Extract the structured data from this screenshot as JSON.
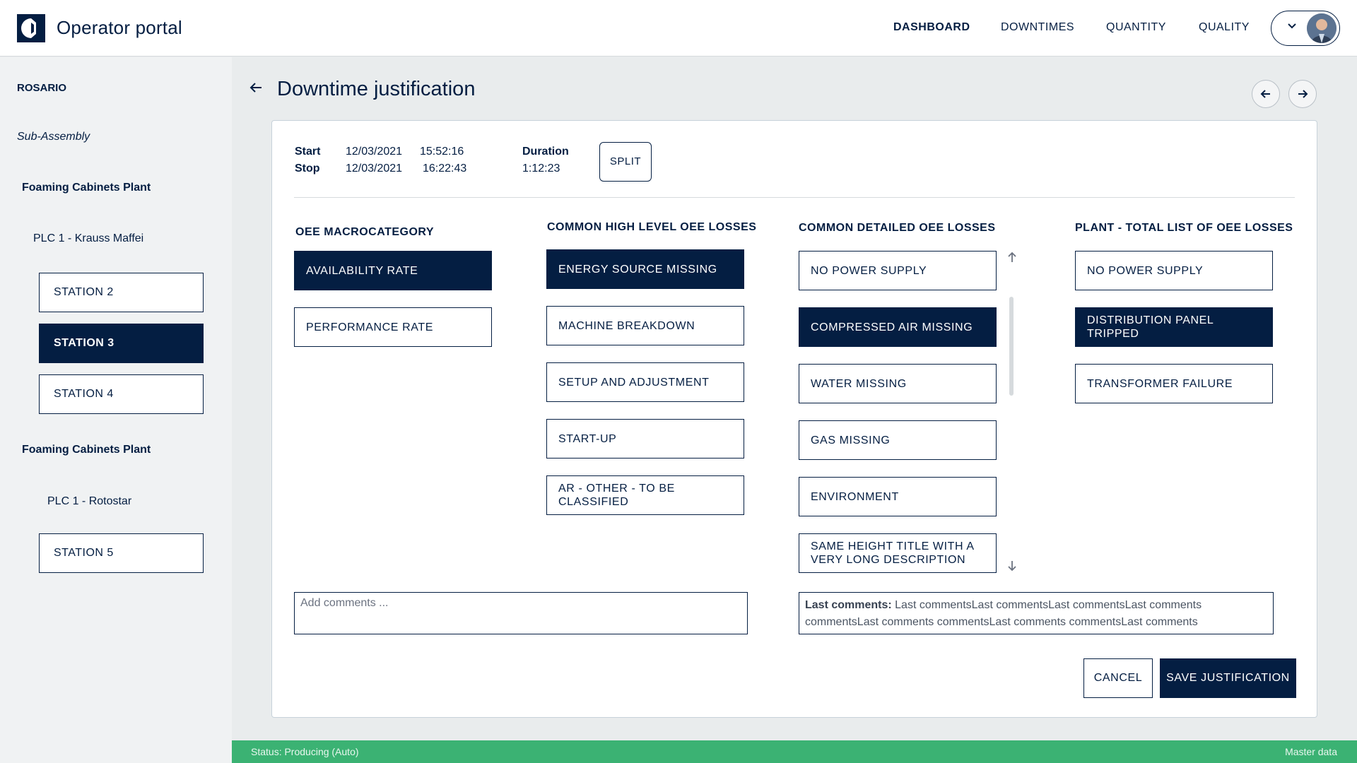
{
  "header": {
    "app_title": "Operator portal",
    "nav": [
      "DASHBOARD",
      "DOWNTIMES",
      "QUANTITY",
      "QUALITY"
    ],
    "active_nav": "DASHBOARD"
  },
  "sidebar": {
    "site": "ROSARIO",
    "area": "Sub-Assembly",
    "groups": [
      {
        "plant": "Foaming Cabinets Plant",
        "plc": "PLC 1 - Krauss Maffei",
        "stations": [
          "STATION 2",
          "STATION 3",
          "STATION 4"
        ]
      },
      {
        "plant": "Foaming Cabinets Plant",
        "plc": "PLC 1 - Rotostar",
        "stations": [
          "STATION 5"
        ]
      }
    ],
    "active_station": "STATION 3"
  },
  "page": {
    "title": "Downtime justification"
  },
  "downtime": {
    "start_label": "Start",
    "start_date": "12/03/2021",
    "start_time": "15:52:16",
    "stop_label": "Stop",
    "stop_date": "12/03/2021",
    "stop_time": "16:22:43",
    "duration_label": "Duration",
    "duration_value": "1:12:23",
    "split_label": "SPLIT"
  },
  "columns": [
    {
      "title": "OEE MACROCATEGORY",
      "items": [
        "AVAILABILITY RATE",
        "PERFORMANCE RATE"
      ],
      "selected": 0
    },
    {
      "title": "COMMON HIGH LEVEL OEE LOSSES",
      "items": [
        "ENERGY SOURCE MISSING",
        "MACHINE BREAKDOWN",
        "SETUP AND ADJUSTMENT",
        "START-UP",
        "AR - OTHER - TO BE CLASSIFIED"
      ],
      "selected": 0
    },
    {
      "title": "COMMON DETAILED OEE LOSSES",
      "items": [
        "NO POWER SUPPLY",
        "COMPRESSED AIR MISSING",
        "WATER MISSING",
        "GAS MISSING",
        "ENVIRONMENT",
        "SAME HEIGHT TITLE WITH A VERY LONG DESCRIPTION"
      ],
      "selected": 1
    },
    {
      "title": "PLANT - TOTAL LIST OF OEE LOSSES",
      "items": [
        "NO POWER SUPPLY",
        "DISTRIBUTION PANEL TRIPPED",
        "TRANSFORMER FAILURE"
      ],
      "selected": 1
    }
  ],
  "comments": {
    "placeholder": "Add comments ...",
    "last_label": "Last comments:",
    "last_text": "Last commentsLast commentsLast commentsLast comments commentsLast comments commentsLast comments commentsLast comments"
  },
  "actions": {
    "cancel": "CANCEL",
    "save": "SAVE JUSTIFICATION"
  },
  "statusbar": {
    "status": "Status: Producing (Auto)",
    "master_data": "Master data"
  },
  "colors": {
    "navy": "#041e42",
    "status_green": "#3bb273",
    "background": "#e9eced"
  }
}
